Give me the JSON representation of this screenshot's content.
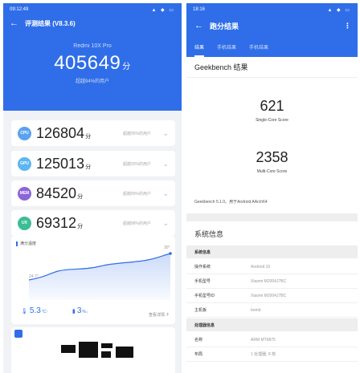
{
  "left": {
    "status_time": "09:12:49",
    "status_icons": "▲ ◆ ▭",
    "title": "评测结果 (V8.3.6)",
    "device": "Redmi 10X Pro",
    "total_score": "405649",
    "score_unit": "分",
    "beat_text": "超越94%的用户",
    "sub_scores": [
      {
        "icon": "CPU",
        "value": "126804",
        "pct": "超越95%的用户",
        "color": "#5aa2ef"
      },
      {
        "icon": "GPU",
        "value": "125013",
        "pct": "超越93%的用户",
        "color": "#5bb6f2"
      },
      {
        "icon": "MEM",
        "value": "84520",
        "pct": "超越89%的用户",
        "color": "#8a66d8"
      },
      {
        "icon": "UX",
        "value": "69312",
        "pct": "超越88%的用户",
        "color": "#3dbd95"
      }
    ],
    "chart": {
      "title": "满分温度",
      "start_label": "24.7°",
      "end_label": "30°",
      "temp_rise": "5.3",
      "temp_unit": "°C↑",
      "battery": "3",
      "battery_unit": "%↓",
      "detail_label": "查看详情",
      "line_color": "#2f6ee8"
    }
  },
  "right": {
    "status_time": "18:16",
    "status_icons": "▲ ◆ ▭",
    "title": "跑分结果",
    "tabs": [
      "结果",
      "手机结果",
      "手机结果"
    ],
    "gb_title": "Geekbench 结果",
    "single_score": "621",
    "single_label": "Single-Core Score",
    "multi_score": "2358",
    "multi_label": "Multi-Core Score",
    "version": "Geekbench 5.1.0。用于Android AArch64",
    "sys_title": "系统信息",
    "section1": "系统信息",
    "rows1": [
      {
        "k": "操作系统",
        "v": "Android 10"
      },
      {
        "k": "手机型号",
        "v": "Xiaomi M2004J7BC"
      },
      {
        "k": "手机型号ID",
        "v": "Xiaomi M2004J7BC"
      },
      {
        "k": "主机板",
        "v": "bomb"
      }
    ],
    "section2": "处理器信息",
    "rows2": [
      {
        "k": "名称",
        "v": "ARM MT6875"
      },
      {
        "k": "布局",
        "v": "1 处理器, 8 核"
      }
    ]
  },
  "colors": {
    "brand": "#2f6ee8",
    "bg": "#f0f2f6"
  }
}
